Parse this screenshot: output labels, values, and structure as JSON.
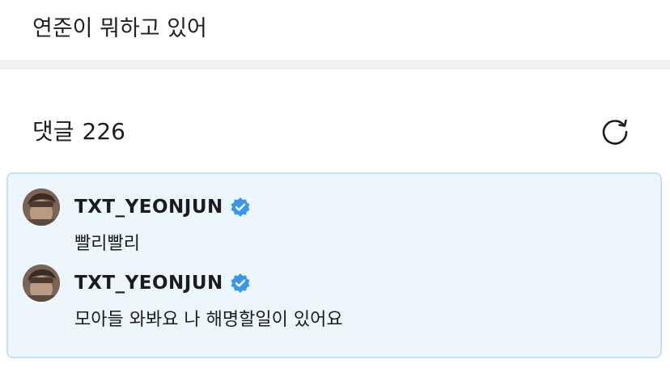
{
  "post": {
    "text": "연준이 뭐하고 있어"
  },
  "comments": {
    "title": "댓글",
    "count": "226",
    "refresh_icon": "refresh-icon",
    "items": [
      {
        "author": "TXT_YEONJUN",
        "verified": true,
        "text": "빨리빨리"
      },
      {
        "author": "TXT_YEONJUN",
        "verified": true,
        "text": "모아들 와봐요 나 해명할일이 있어요"
      }
    ]
  },
  "colors": {
    "highlight_bg": "#edf6fc",
    "highlight_border": "#c8e1f1",
    "verified_blue": "#3b96e8"
  }
}
